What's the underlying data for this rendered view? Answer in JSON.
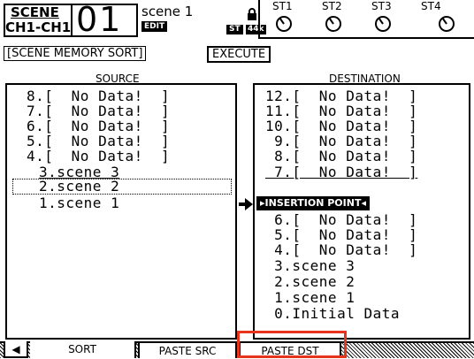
{
  "header": {
    "scene_label": "SCENE",
    "ch_label": "CH1-CH1",
    "scene_number": "01",
    "scene_name": "scene 1",
    "edit_badge": "EDIT",
    "st_badge": "ST",
    "rate_badge": "44k",
    "st_channels": [
      "ST1",
      "ST2",
      "ST3",
      "ST4"
    ]
  },
  "page_title": "SCENE MEMORY SORT",
  "execute_label": "EXECUTE",
  "source": {
    "header": "SOURCE",
    "rows": [
      "8.[  No Data!  ]",
      "7.[  No Data!  ]",
      "6.[  No Data!  ]",
      "5.[  No Data!  ]",
      "4.[  No Data!  ]",
      "3.scene 3",
      "2.scene 2",
      "1.scene 1"
    ]
  },
  "destination": {
    "header": "DESTINATION",
    "rows_top": [
      "12.[  No Data!  ]",
      "11.[  No Data!  ]",
      "10.[  No Data!  ]",
      " 9.[  No Data!  ]",
      " 8.[  No Data!  ]",
      " 7.[  No Data!  ]"
    ],
    "insertion_point": "INSERTION POINT",
    "rows_bottom": [
      " 6.[  No Data!  ]",
      " 5.[  No Data!  ]",
      " 4.[  No Data!  ]",
      " 3.scene 3",
      " 2.scene 2",
      " 1.scene 1",
      " 0.Initial Data"
    ]
  },
  "tabs": [
    "SORT",
    "PASTE SRC",
    "PASTE DST"
  ]
}
